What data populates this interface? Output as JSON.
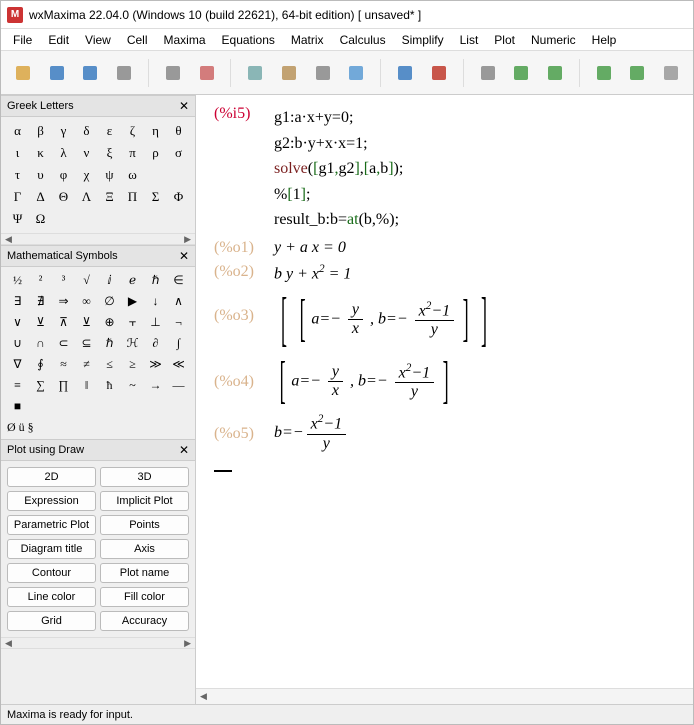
{
  "window": {
    "title": "wxMaxima 22.04.0 (Windows 10 (build 22621), 64-bit edition) [ unsaved* ]",
    "appicon_letter": "M"
  },
  "menu": [
    "File",
    "Edit",
    "View",
    "Cell",
    "Maxima",
    "Equations",
    "Matrix",
    "Calculus",
    "Simplify",
    "List",
    "Plot",
    "Numeric",
    "Help"
  ],
  "toolbar_icons": [
    "new-file",
    "open-file",
    "save-file",
    "print",
    "preferences",
    "cut",
    "copy",
    "paste",
    "find",
    "select",
    "run",
    "stop",
    "up",
    "prev",
    "next",
    "down",
    "last",
    "eye"
  ],
  "panels": {
    "greek": {
      "title": "Greek Letters",
      "letters": [
        "α",
        "β",
        "γ",
        "δ",
        "ε",
        "ζ",
        "η",
        "θ",
        "ι",
        "κ",
        "λ",
        "ν",
        "ξ",
        "π",
        "ρ",
        "σ",
        "τ",
        "υ",
        "φ",
        "χ",
        "ψ",
        "ω",
        "",
        "",
        "Γ",
        "Δ",
        "Θ",
        "Λ",
        "Ξ",
        "Π",
        "Σ",
        "Φ",
        "Ψ",
        "Ω",
        "",
        "",
        "",
        "",
        "",
        ""
      ]
    },
    "symbols": {
      "title": "Mathematical Symbols",
      "items": [
        "½",
        "²",
        "³",
        "√",
        "ⅈ",
        "ℯ",
        "ℏ",
        "∈",
        "∃",
        "∄",
        "⇒",
        "∞",
        "∅",
        "▶",
        "↓",
        "∧",
        "∨",
        "⊻",
        "⊼",
        "⊻",
        "⊕",
        "⫟",
        "⊥",
        "¬",
        "∪",
        "∩",
        "⊂",
        "⊆",
        "ℏ",
        "ℋ",
        "∂",
        "∫",
        "∇",
        "∮",
        "≈",
        "≠",
        "≤",
        "≥",
        "≫",
        "≪",
        "≡",
        "∑",
        "∏",
        "‖",
        "ħ",
        "~",
        "→",
        "—",
        "■",
        "",
        "",
        "",
        "",
        "",
        ""
      ],
      "footer": "Ø ü §"
    },
    "plot": {
      "title": "Plot using Draw",
      "buttons": [
        "2D",
        "3D",
        "Expression",
        "Implicit Plot",
        "Parametric Plot",
        "Points",
        "Diagram title",
        "Axis",
        "Contour",
        "Plot name",
        "Line color",
        "Fill color",
        "Grid",
        "Accuracy"
      ]
    }
  },
  "session": {
    "input_label": "(%i5)",
    "input_lines": [
      {
        "parts": [
          {
            "t": "g1",
            "c": "var"
          },
          {
            "t": ":",
            "c": "op"
          },
          {
            "t": "a·x",
            "c": "var"
          },
          {
            "t": "+",
            "c": "op"
          },
          {
            "t": "y",
            "c": "var"
          },
          {
            "t": "=",
            "c": "op"
          },
          {
            "t": "0",
            "c": "var"
          },
          {
            "t": ";",
            "c": "op"
          }
        ]
      },
      {
        "parts": [
          {
            "t": "g2",
            "c": "var"
          },
          {
            "t": ":",
            "c": "op"
          },
          {
            "t": "b·y",
            "c": "var"
          },
          {
            "t": "+",
            "c": "op"
          },
          {
            "t": "x·x",
            "c": "var"
          },
          {
            "t": "=",
            "c": "op"
          },
          {
            "t": "1",
            "c": "var"
          },
          {
            "t": ";",
            "c": "op"
          }
        ]
      },
      {
        "parts": [
          {
            "t": "solve",
            "c": "kw"
          },
          {
            "t": "(",
            "c": "op"
          },
          {
            "t": "[",
            "c": "fn"
          },
          {
            "t": "g1",
            "c": "var"
          },
          {
            "t": ",",
            "c": "fn"
          },
          {
            "t": "g2",
            "c": "var"
          },
          {
            "t": "]",
            "c": "fn"
          },
          {
            "t": ",",
            "c": "op"
          },
          {
            "t": "[",
            "c": "fn"
          },
          {
            "t": "a",
            "c": "var"
          },
          {
            "t": ",",
            "c": "fn"
          },
          {
            "t": "b",
            "c": "var"
          },
          {
            "t": "]",
            "c": "fn"
          },
          {
            "t": ")",
            "c": "op"
          },
          {
            "t": ";",
            "c": "op"
          }
        ]
      },
      {
        "parts": [
          {
            "t": "%",
            "c": "var"
          },
          {
            "t": "[",
            "c": "fn"
          },
          {
            "t": "1",
            "c": "var"
          },
          {
            "t": "]",
            "c": "fn"
          },
          {
            "t": ";",
            "c": "op"
          }
        ]
      },
      {
        "parts": [
          {
            "t": "result_b",
            "c": "var"
          },
          {
            "t": ":",
            "c": "op"
          },
          {
            "t": "b",
            "c": "var"
          },
          {
            "t": "=",
            "c": "op"
          },
          {
            "t": "at",
            "c": "fn"
          },
          {
            "t": "(",
            "c": "op"
          },
          {
            "t": "b",
            "c": "var"
          },
          {
            "t": ",",
            "c": "op"
          },
          {
            "t": "%",
            "c": "var"
          },
          {
            "t": ")",
            "c": "op"
          },
          {
            "t": ";",
            "c": "op"
          }
        ]
      }
    ],
    "o1_label": "(%o1)",
    "o1_txt_a": "y",
    "o1_txt_b": "+",
    "o1_txt_c": "a x",
    "o1_txt_d": "=",
    "o1_txt_e": "0",
    "o2_label": "(%o2)",
    "o2_a": "b y",
    "o2_b": "+",
    "o2_c": "x",
    "o2_exp": "2",
    "o2_d": "=",
    "o2_e": "1",
    "o3_label": "(%o3)",
    "o4_label": "(%o4)",
    "o5_label": "(%o5)",
    "eq_a_lhs": "a",
    "eq_eq": "=",
    "eq_minus": "−",
    "frac1_num": "y",
    "frac1_den": "x",
    "eq_b_lhs": "b",
    "frac2_num_a": "x",
    "frac2_exp": "2",
    "frac2_num_b": "−1",
    "frac2_den": "y",
    "comma": ","
  },
  "status": "Maxima is ready for input."
}
